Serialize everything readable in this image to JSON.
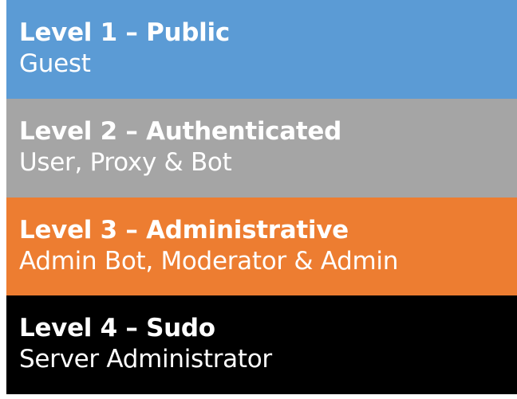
{
  "levels": [
    {
      "title": "Level 1 – Public",
      "description": "Guest",
      "color": "#5b9bd5"
    },
    {
      "title": "Level 2 – Authenticated",
      "description": "User, Proxy & Bot",
      "color": "#a5a5a5"
    },
    {
      "title": "Level 3 – Administrative",
      "description": "Admin Bot, Moderator & Admin",
      "color": "#ed7d31"
    },
    {
      "title": "Level 4 – Sudo",
      "description": "Server Administrator",
      "color": "#000000"
    }
  ]
}
